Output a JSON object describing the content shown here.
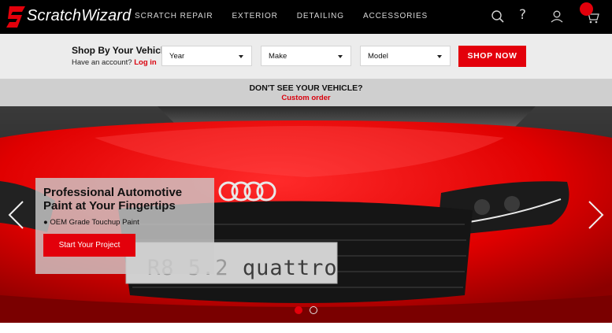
{
  "brand": {
    "name": "ScratchWizard",
    "accent": "#e3000b"
  },
  "nav": {
    "items": [
      "SCRATCH REPAIR",
      "EXTERIOR",
      "DETAILING",
      "ACCESSORIES"
    ],
    "icons": [
      "search-icon",
      "help-icon",
      "account-icon",
      "cart-icon"
    ]
  },
  "vehicle_selector": {
    "title": "Shop By Your Vehicle",
    "account_prompt": "Have an account?",
    "login_link": "Log in",
    "year": "Year",
    "make": "Make",
    "model": "Model",
    "submit": "SHOP NOW"
  },
  "custom_order": {
    "title": "DON'T SEE YOUR VEHICLE?",
    "link": "Custom order"
  },
  "hero": {
    "plate_left": "R8 5.2",
    "plate_right": "quattro",
    "promo_title": "Professional Automotive Paint at Your Fingertips",
    "promo_bullet": "● OEM Grade Touchup Paint",
    "promo_button": "Start Your Project",
    "slide_count": 2,
    "active_slide": 1
  }
}
